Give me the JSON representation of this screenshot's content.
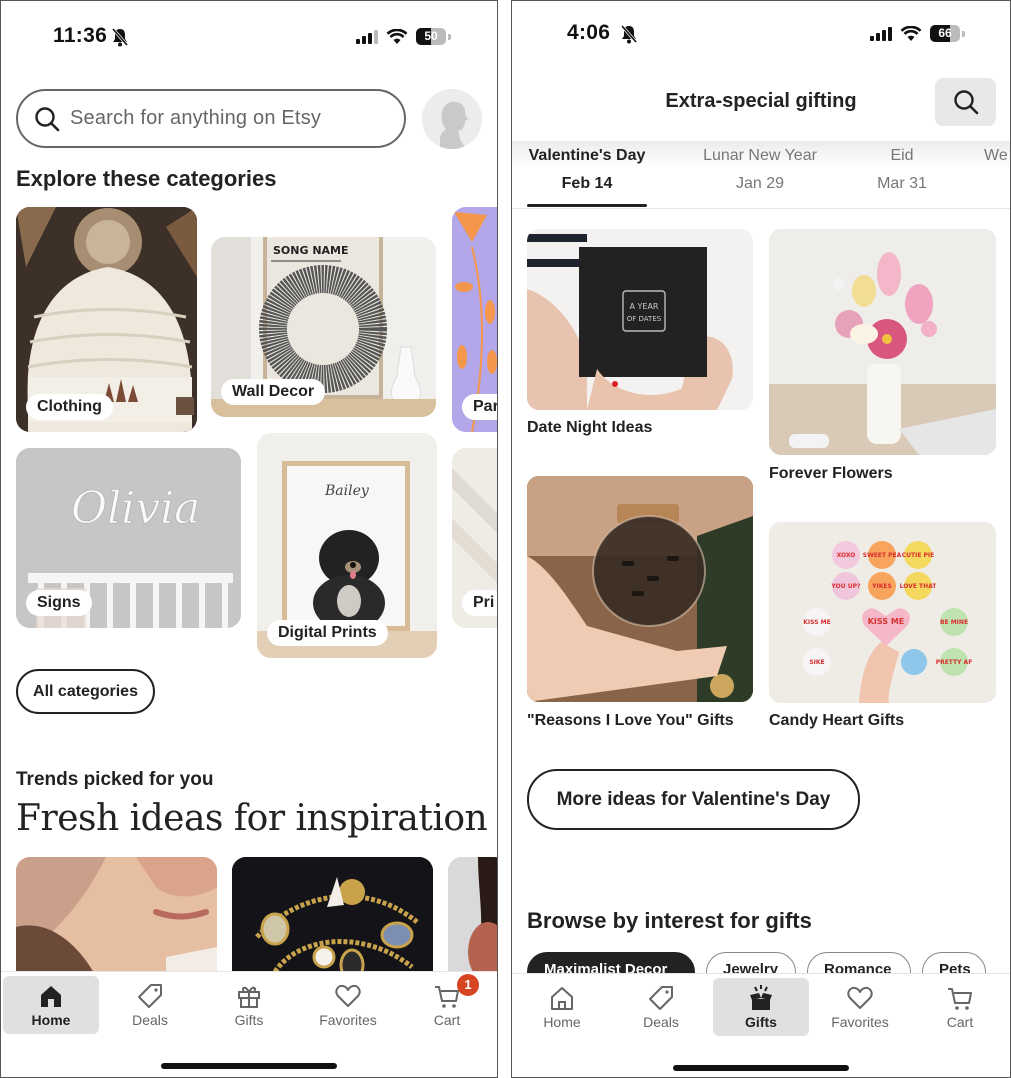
{
  "left_screen": {
    "status_bar": {
      "time": "11:36",
      "battery": "50",
      "battery_fraction": 0.5,
      "silent": true
    },
    "search": {
      "placeholder": "Search for anything on Etsy"
    },
    "categories": {
      "title": "Explore these categories",
      "items": [
        {
          "label": "Clothing"
        },
        {
          "label": "Wall Decor"
        },
        {
          "label": "Par"
        },
        {
          "label": "Signs"
        },
        {
          "label": "Digital Prints"
        },
        {
          "label": "Pri"
        }
      ],
      "image_texts": {
        "wall_decor_poster": "SONG NAME",
        "signs_name": "Olivia",
        "print_name": "Bailey"
      },
      "all_button": "All categories"
    },
    "trends": {
      "subtitle": "Trends picked for you",
      "title": "Fresh ideas for inspiration"
    },
    "bottom_nav": {
      "items": [
        {
          "label": "Home",
          "icon": "home-icon",
          "active": true
        },
        {
          "label": "Deals",
          "icon": "tag-icon",
          "active": false
        },
        {
          "label": "Gifts",
          "icon": "gift-icon",
          "active": false
        },
        {
          "label": "Favorites",
          "icon": "heart-icon",
          "active": false
        },
        {
          "label": "Cart",
          "icon": "cart-icon",
          "active": false,
          "badge": "1"
        }
      ]
    }
  },
  "right_screen": {
    "status_bar": {
      "time": "4:06",
      "battery": "66",
      "battery_fraction": 0.66,
      "silent": true
    },
    "header": {
      "title": "Extra-special gifting"
    },
    "holiday_tabs": [
      {
        "name": "Valentine's Day",
        "date": "Feb 14",
        "active": true
      },
      {
        "name": "Lunar New Year",
        "date": "Jan 29",
        "active": false
      },
      {
        "name": "Eid",
        "date": "Mar 31",
        "active": false
      },
      {
        "name": "We",
        "date": "",
        "active": false
      }
    ],
    "gift_ideas": [
      {
        "label": "Date Night Ideas",
        "image_text": "A YEAR OF DATES"
      },
      {
        "label": "Forever Flowers"
      },
      {
        "label": "\"Reasons I Love You\" Gifts"
      },
      {
        "label": "Candy Heart Gifts",
        "image_text": "KISS ME"
      }
    ],
    "more_button": "More ideas for Valentine's Day",
    "browse": {
      "title": "Browse by interest for gifts",
      "chips": [
        "Maximalist Decor",
        "Jewelry",
        "Romance",
        "Pets"
      ]
    },
    "bottom_nav": {
      "items": [
        {
          "label": "Home",
          "icon": "home-icon",
          "active": false
        },
        {
          "label": "Deals",
          "icon": "tag-icon",
          "active": false
        },
        {
          "label": "Gifts",
          "icon": "gift-box-open-icon",
          "active": true
        },
        {
          "label": "Favorites",
          "icon": "heart-icon",
          "active": false
        },
        {
          "label": "Cart",
          "icon": "cart-icon",
          "active": false
        }
      ]
    }
  },
  "colors": {
    "badge": "#d64521",
    "text": "#222222",
    "nav_active_bg": "#e0e0e0"
  }
}
